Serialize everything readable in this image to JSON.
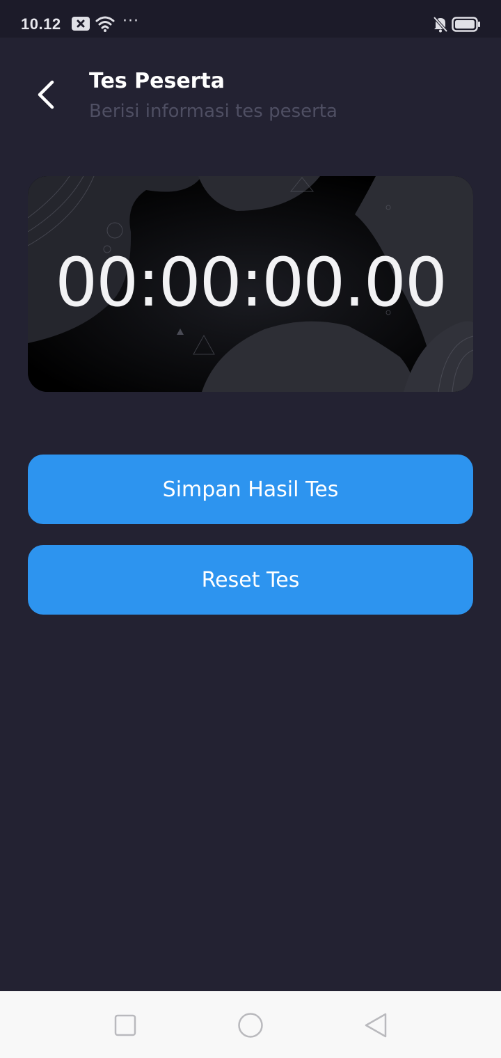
{
  "status_bar": {
    "time": "10.12",
    "more": "···",
    "icons": [
      "notification-x-icon",
      "wifi-icon",
      "more-icon",
      "mute-icon",
      "battery-icon"
    ]
  },
  "header": {
    "title": "Tes Peserta",
    "subtitle": "Berisi informasi tes peserta",
    "back_icon": "chevron-left-icon"
  },
  "timer": {
    "value": "00:00:00.00"
  },
  "actions": {
    "save_label": "Simpan Hasil Tes",
    "reset_label": "Reset Tes"
  },
  "nav_bar": {
    "icons": [
      "recent-apps-icon",
      "home-icon",
      "back-icon"
    ]
  },
  "colors": {
    "background": "#232232",
    "status_bar": "#1c1b29",
    "accent": "#2d94ef",
    "subtitle": "#4f4f63",
    "nav_bar": "#f8f8f8"
  }
}
